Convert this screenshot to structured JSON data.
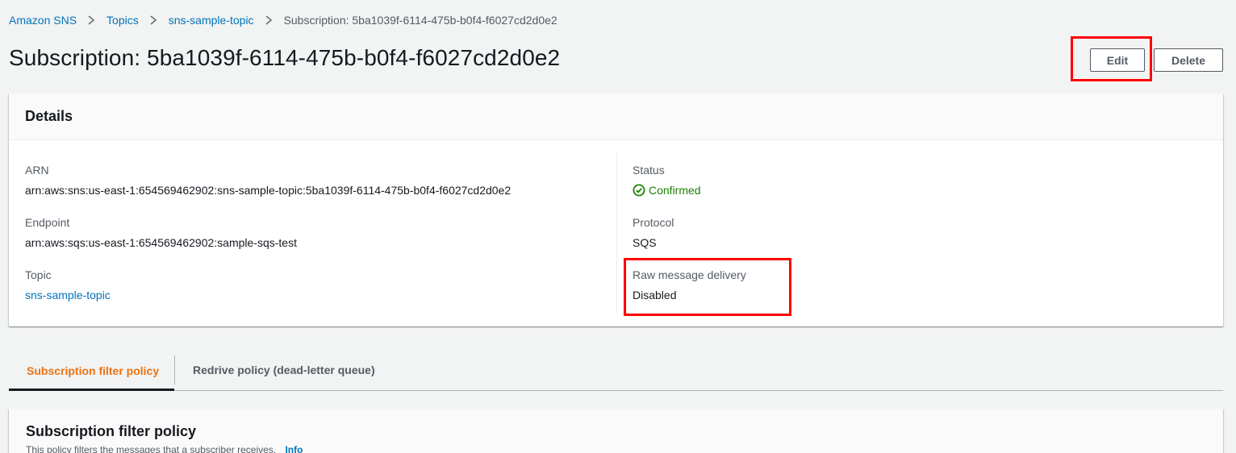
{
  "breadcrumb": {
    "items": [
      {
        "label": "Amazon SNS"
      },
      {
        "label": "Topics"
      },
      {
        "label": "sns-sample-topic"
      },
      {
        "label": "Subscription: 5ba1039f-6114-475b-b0f4-f6027cd2d0e2"
      }
    ]
  },
  "header": {
    "title": "Subscription: 5ba1039f-6114-475b-b0f4-f6027cd2d0e2",
    "edit_label": "Edit",
    "delete_label": "Delete"
  },
  "details": {
    "title": "Details",
    "arn": {
      "label": "ARN",
      "value": "arn:aws:sns:us-east-1:654569462902:sns-sample-topic:5ba1039f-6114-475b-b0f4-f6027cd2d0e2"
    },
    "endpoint": {
      "label": "Endpoint",
      "value": "arn:aws:sqs:us-east-1:654569462902:sample-sqs-test"
    },
    "topic": {
      "label": "Topic",
      "value": "sns-sample-topic"
    },
    "status": {
      "label": "Status",
      "value": "Confirmed",
      "icon": "check-circle-icon",
      "color": "#1d8102"
    },
    "protocol": {
      "label": "Protocol",
      "value": "SQS"
    },
    "raw_delivery": {
      "label": "Raw message delivery",
      "value": "Disabled"
    }
  },
  "tabs": [
    {
      "label": "Subscription filter policy",
      "active": true
    },
    {
      "label": "Redrive policy (dead-letter queue)",
      "active": false
    }
  ],
  "filter_policy": {
    "title": "Subscription filter policy",
    "description": "This policy filters the messages that a subscriber receives.",
    "info_label": "Info"
  },
  "colors": {
    "accent_link": "#0073bb",
    "active_tab": "#ec7211",
    "success": "#1d8102",
    "highlight": "#ff0000"
  }
}
